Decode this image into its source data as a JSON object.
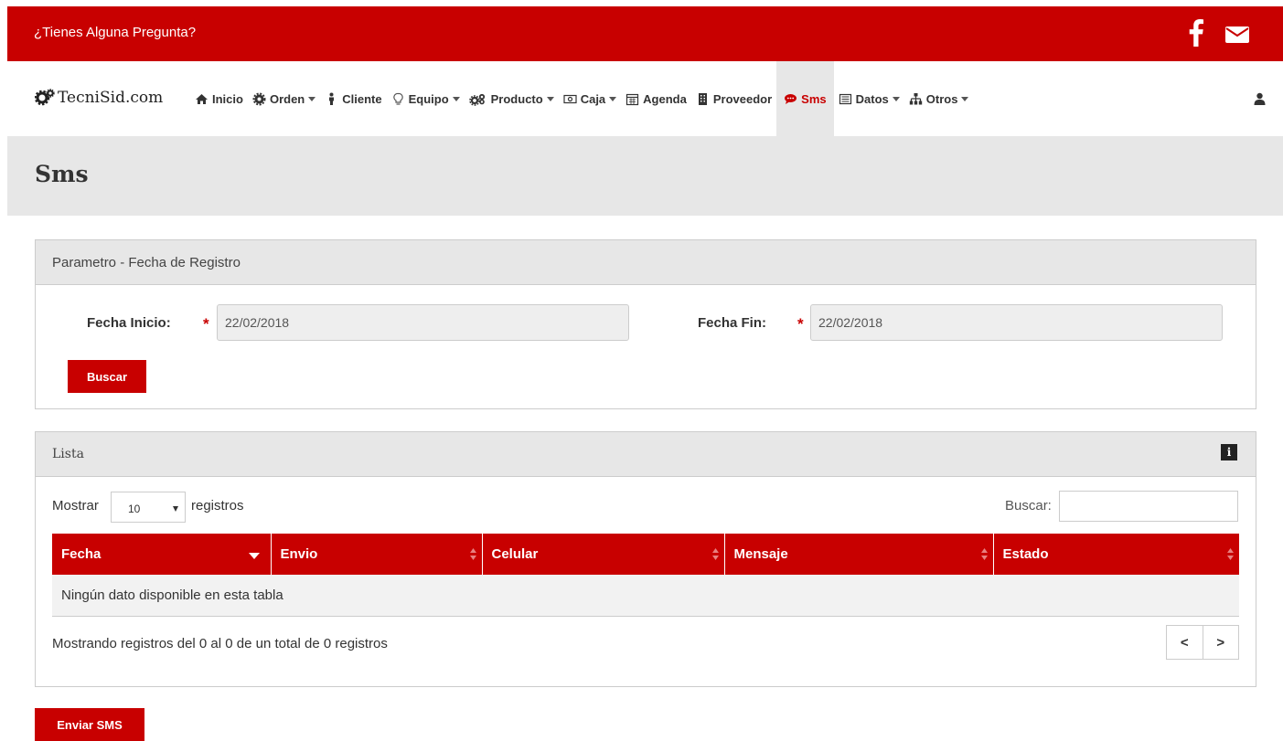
{
  "topbar": {
    "question": "¿Tienes Alguna Pregunta?",
    "icons": [
      "facebook-icon",
      "envelope-icon"
    ],
    "color": "#c80000"
  },
  "brand": {
    "name": "TecniSid.com",
    "icon": "gears-icon"
  },
  "nav": {
    "items": [
      {
        "label": "Inicio",
        "icon": "home-icon",
        "dropdown": false
      },
      {
        "label": "Orden",
        "icon": "gear-icon",
        "dropdown": true
      },
      {
        "label": "Cliente",
        "icon": "person-icon",
        "dropdown": false
      },
      {
        "label": "Equipo",
        "icon": "lightbulb-icon",
        "dropdown": true
      },
      {
        "label": "Producto",
        "icon": "gears-icon",
        "dropdown": true
      },
      {
        "label": "Caja",
        "icon": "money-icon",
        "dropdown": true
      },
      {
        "label": "Agenda",
        "icon": "calendar-icon",
        "dropdown": false
      },
      {
        "label": "Proveedor",
        "icon": "building-icon",
        "dropdown": false
      },
      {
        "label": "Sms",
        "icon": "comment-icon",
        "dropdown": false,
        "active": true
      },
      {
        "label": "Datos",
        "icon": "list-icon",
        "dropdown": true
      },
      {
        "label": "Otros",
        "icon": "sitemap-icon",
        "dropdown": true
      }
    ],
    "user_icon": "user-icon"
  },
  "page": {
    "title": "Sms"
  },
  "params_panel": {
    "title": "Parametro - Fecha de Registro",
    "fecha_inicio_label": "Fecha Inicio:",
    "fecha_inicio_value": "22/02/2018",
    "fecha_fin_label": "Fecha Fin:",
    "fecha_fin_value": "22/02/2018",
    "required_mark": "*",
    "buscar_button": "Buscar"
  },
  "list_panel": {
    "title": "Lista",
    "info_icon": "i",
    "mostrar": "Mostrar",
    "length_value": "10",
    "registros": "registros",
    "search_label": "Buscar:",
    "search_value": "",
    "columns": [
      "Fecha",
      "Envio",
      "Celular",
      "Mensaje",
      "Estado"
    ],
    "empty_message": "Ningún dato disponible en esta tabla",
    "info": "Mostrando registros del 0 al 0 de un total de 0 registros",
    "prev": "<",
    "next": ">"
  },
  "enviar_button": "Enviar SMS"
}
